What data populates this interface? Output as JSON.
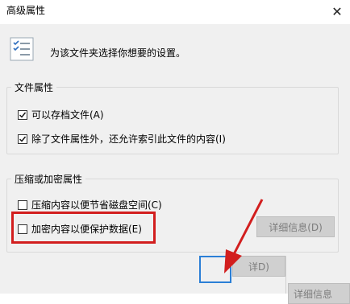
{
  "window": {
    "title": "高级属性",
    "close_glyph": "✕"
  },
  "header": {
    "description": "为该文件夹选择你想要的设置。",
    "icon": "properties-list-icon"
  },
  "file_attributes": {
    "legend": "文件属性",
    "archive_label": "可以存档文件(A)",
    "archive_checked": true,
    "index_label": "除了文件属性外，还允许索引此文件的内容(I)",
    "index_checked": true
  },
  "compress_encrypt": {
    "legend": "压缩或加密属性",
    "compress_label": "压缩内容以便节省磁盘空间(C)",
    "compress_checked": false,
    "encrypt_label": "加密内容以便保护数据(E)",
    "encrypt_checked": false,
    "details_button": "详细信息(D)"
  },
  "overlay": {
    "zoom_button_partial": "详D)",
    "zoom_button_partial_2": "详细信息",
    "annotation_color": "#d21e1e",
    "focus_color": "#2b7fd6"
  }
}
